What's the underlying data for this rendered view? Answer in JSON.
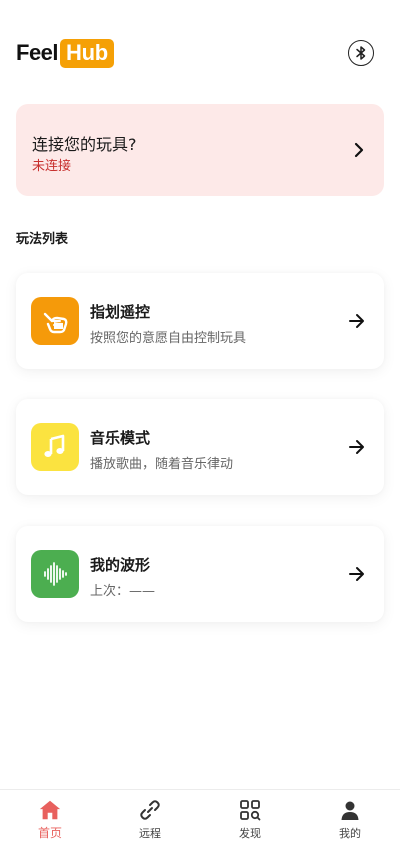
{
  "header": {
    "logo_part1": "Feel",
    "logo_part2": "Hub",
    "logo_accent": "#f5a006",
    "bluetooth_icon": "bluetooth-icon"
  },
  "connect": {
    "title": "连接您的玩具?",
    "status": "未连接",
    "status_color": "#c8312f",
    "background": "#fde9e8"
  },
  "section": {
    "title": "玩法列表"
  },
  "modes": [
    {
      "title": "指划遥控",
      "desc": "按照您的意愿自由控制玩具",
      "icon": "swipe-hand-icon",
      "color": "#f59a0a"
    },
    {
      "title": "音乐模式",
      "desc": "播放歌曲，随着音乐律动",
      "icon": "music-note-icon",
      "color": "#fbe340"
    },
    {
      "title": "我的波形",
      "desc": "上次：——",
      "icon": "waveform-icon",
      "color": "#4cae50"
    }
  ],
  "nav": {
    "active_color": "#e8615e",
    "items": [
      {
        "label": "首页",
        "icon": "home-icon"
      },
      {
        "label": "远程",
        "icon": "link-icon"
      },
      {
        "label": "发现",
        "icon": "discover-grid-icon"
      },
      {
        "label": "我的",
        "icon": "user-icon"
      }
    ]
  }
}
